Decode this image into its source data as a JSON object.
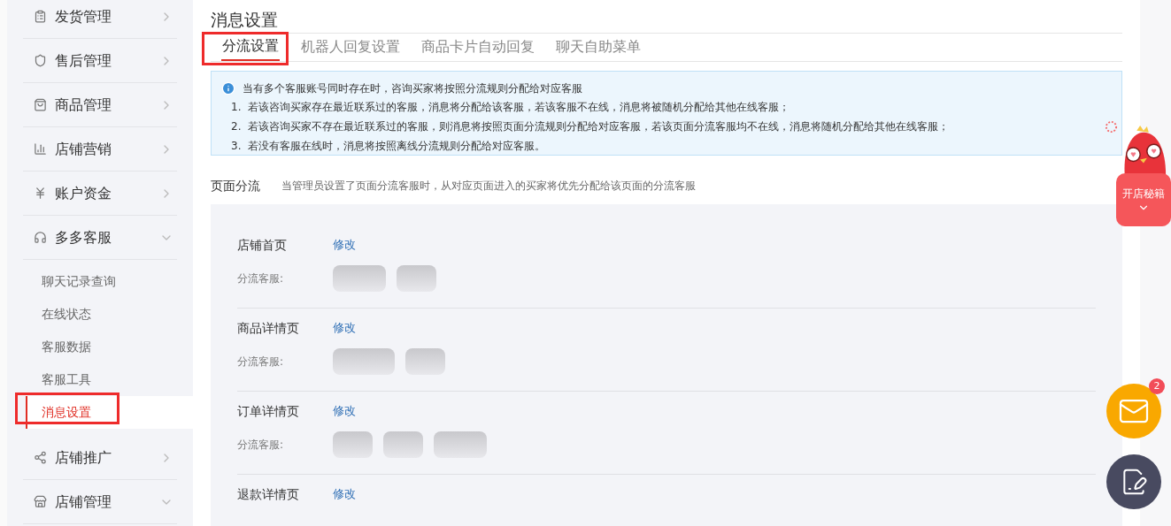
{
  "sidebar": {
    "items": [
      {
        "label": "发货管理",
        "expanded": false
      },
      {
        "label": "售后管理",
        "expanded": false
      },
      {
        "label": "商品管理",
        "expanded": false
      },
      {
        "label": "店铺营销",
        "expanded": false
      },
      {
        "label": "账户资金",
        "expanded": false
      },
      {
        "label": "多多客服",
        "expanded": true,
        "children": [
          {
            "label": "聊天记录查询",
            "selected": false
          },
          {
            "label": "在线状态",
            "selected": false
          },
          {
            "label": "客服数据",
            "selected": false
          },
          {
            "label": "客服工具",
            "selected": false
          },
          {
            "label": "消息设置",
            "selected": true
          }
        ]
      },
      {
        "label": "店铺推广",
        "expanded": false
      },
      {
        "label": "店铺管理",
        "expanded": true
      }
    ]
  },
  "page": {
    "title": "消息设置",
    "tabs": [
      {
        "label": "分流设置",
        "selected": true
      },
      {
        "label": "机器人回复设置",
        "selected": false
      },
      {
        "label": "商品卡片自动回复",
        "selected": false
      },
      {
        "label": "聊天自助菜单",
        "selected": false
      }
    ],
    "notice": {
      "heading": "当有多个客服账号同时存在时，咨询买家将按照分流规则分配给对应客服",
      "points": [
        {
          "number": "1.",
          "text": "若该咨询买家存在最近联系过的客服，消息将分配给该客服，若该客服不在线，消息将被随机分配给其他在线客服；"
        },
        {
          "number": "2.",
          "text": "若该咨询买家不存在最近联系过的客服，则消息将按照页面分流规则分配给对应客服，若该页面分流客服均不在线，消息将随机分配给其他在线客服；"
        },
        {
          "number": "3.",
          "text": "若没有客服在线时，消息将按照离线分流规则分配给对应客服。"
        }
      ]
    },
    "section": {
      "title": "页面分流",
      "description": "当管理员设置了页面分流客服时，从对应页面进入的买家将优先分配给该页面的分流客服"
    },
    "pages": [
      {
        "name": "店铺首页",
        "action": "修改",
        "agents_label": "分流客服:"
      },
      {
        "name": "商品详情页",
        "action": "修改",
        "agents_label": "分流客服:"
      },
      {
        "name": "订单详情页",
        "action": "修改",
        "agents_label": "分流客服:"
      },
      {
        "name": "退款详情页",
        "action": "修改"
      }
    ]
  },
  "floating": {
    "promo_label": "开店秘籍",
    "mail_badge": "2"
  }
}
